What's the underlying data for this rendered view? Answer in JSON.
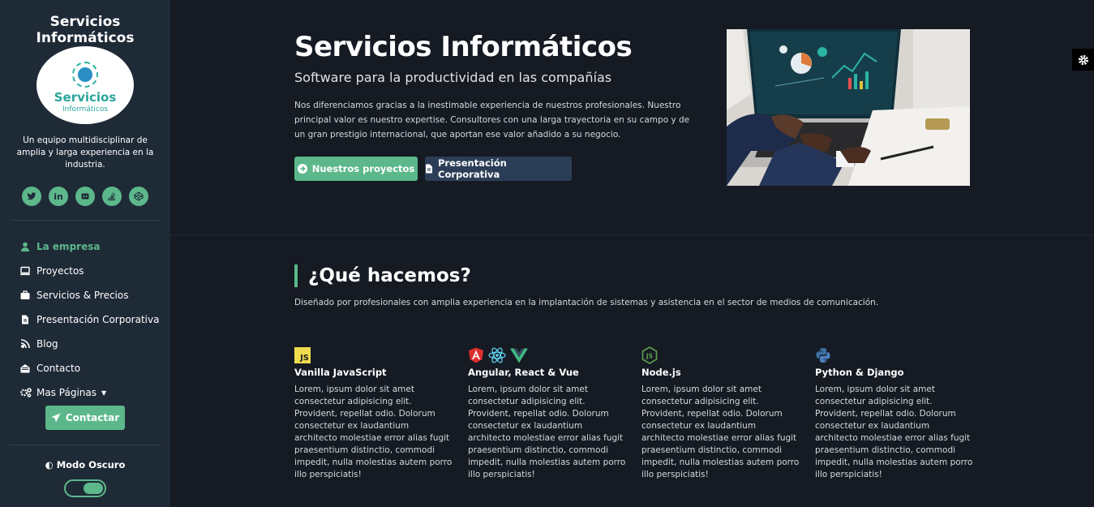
{
  "sidebar": {
    "title": "Servicios Informáticos",
    "logo": {
      "line1": "Servicios",
      "line2": "Informáticos"
    },
    "intro": "Un equipo multidisciplinar de amplia y larga experiencia en la industria.",
    "socials": [
      {
        "icon": "twitter-icon",
        "glyph": "t"
      },
      {
        "icon": "linkedin-icon",
        "glyph": "in"
      },
      {
        "icon": "github-icon",
        "glyph": "◓"
      },
      {
        "icon": "stack-overflow-icon",
        "glyph": "≡"
      },
      {
        "icon": "codepen-icon",
        "glyph": "◈"
      }
    ],
    "nav": [
      {
        "label": "La empresa",
        "icon": "user-icon",
        "active": true
      },
      {
        "label": "Proyectos",
        "icon": "laptop-icon"
      },
      {
        "label": "Servicios & Precios",
        "icon": "briefcase-icon"
      },
      {
        "label": "Presentación Corporativa",
        "icon": "file-icon"
      },
      {
        "label": "Blog",
        "icon": "blog-icon"
      },
      {
        "label": "Contacto",
        "icon": "envelope-open-icon"
      },
      {
        "label": "Mas Páginas",
        "icon": "cogs-icon",
        "dropdown": true
      }
    ],
    "contact_button": "Contactar",
    "dark_mode_label": "Modo Oscuro",
    "dark_mode_on": true
  },
  "hero": {
    "title": "Servicios Informáticos",
    "subtitle": "Software para la productividad en las compañías",
    "text": "Nos diferenciamos gracias a la inestimable experiencia de nuestros profesionales. Nuestro principal valor es nuestro expertise. Consultores con una larga trayectoria en su campo y de un gran prestigio internacional, que aportan ese valor añadido a su negocio.",
    "primary_button": "Nuestros proyectos",
    "secondary_button": "Presentación Corporativa"
  },
  "section": {
    "title": "¿Qué hacemos?",
    "description": "Diseñado por profesionales con amplia experiencia en la implantación de sistemas y asistencia en el sector de medios de comunicación."
  },
  "cards": [
    {
      "title": "Vanilla JavaScript",
      "text": "Lorem, ipsum dolor sit amet consectetur adipisicing elit. Provident, repellat odio. Dolorum consectetur ex laudantium architecto molestiae error alias fugit praesentium distinctio, commodi impedit, nulla molestias autem porro illo perspiciatis!",
      "icons": [
        "javascript-icon"
      ]
    },
    {
      "title": "Angular, React & Vue",
      "text": "Lorem, ipsum dolor sit amet consectetur adipisicing elit. Provident, repellat odio. Dolorum consectetur ex laudantium architecto molestiae error alias fugit praesentium distinctio, commodi impedit, nulla molestias autem porro illo perspiciatis!",
      "icons": [
        "angular-icon",
        "react-icon",
        "vue-icon"
      ]
    },
    {
      "title": "Node.js",
      "text": "Lorem, ipsum dolor sit amet consectetur adipisicing elit. Provident, repellat odio. Dolorum consectetur ex laudantium architecto molestiae error alias fugit praesentium distinctio, commodi impedit, nulla molestias autem porro illo perspiciatis!",
      "icons": [
        "nodejs-icon"
      ]
    },
    {
      "title": "Python & Django",
      "text": "Lorem, ipsum dolor sit amet consectetur adipisicing elit. Provident, repellat odio. Dolorum consectetur ex laudantium architecto molestiae error alias fugit praesentium distinctio, commodi impedit, nulla molestias autem porro illo perspiciatis!",
      "icons": [
        "python-icon"
      ]
    }
  ],
  "colors": {
    "accent": "#5cb88b",
    "sidebar_bg": "#1f2a37",
    "page_bg": "#151a23",
    "secondary_button": "#2c3e57"
  }
}
